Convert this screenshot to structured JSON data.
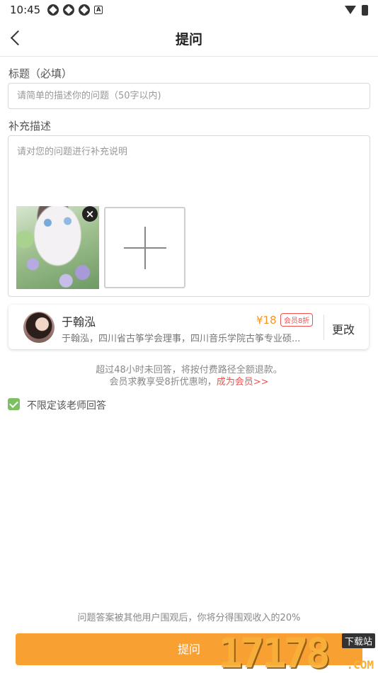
{
  "status_bar": {
    "time": "10:45"
  },
  "nav": {
    "title": "提问"
  },
  "form": {
    "title_label": "标题（必填）",
    "title_placeholder": "请简单的描述你的问题（50字以内)",
    "desc_label": "补充描述",
    "desc_placeholder": "请对您的问题进行补充说明",
    "remove_photo": "×"
  },
  "teacher": {
    "name": "于翰泓",
    "description": "于翰泓，四川省古筝学会理事，四川音乐学院古筝专业硕...",
    "price": "¥18",
    "member_badge": "会员8折",
    "change_label": "更改"
  },
  "notice": {
    "line1": "超过48小时未回答，将按付费路径全额退款。",
    "line2_prefix": "会员求教享受8折优惠哟，",
    "line2_link": "成为会员>>"
  },
  "unrestricted": {
    "label": "不限定该老师回答",
    "checked": true
  },
  "footer": {
    "note": "问题答案被其他用户围观后，你将分得围观收入的20%",
    "submit_label": "提问"
  },
  "watermark": {
    "number": "17178",
    "badge": "下载站",
    "suffix": ".COM"
  },
  "colors": {
    "accent": "#f9a033",
    "price": "#f7951e",
    "link": "#f05050",
    "check": "#7cc063"
  }
}
